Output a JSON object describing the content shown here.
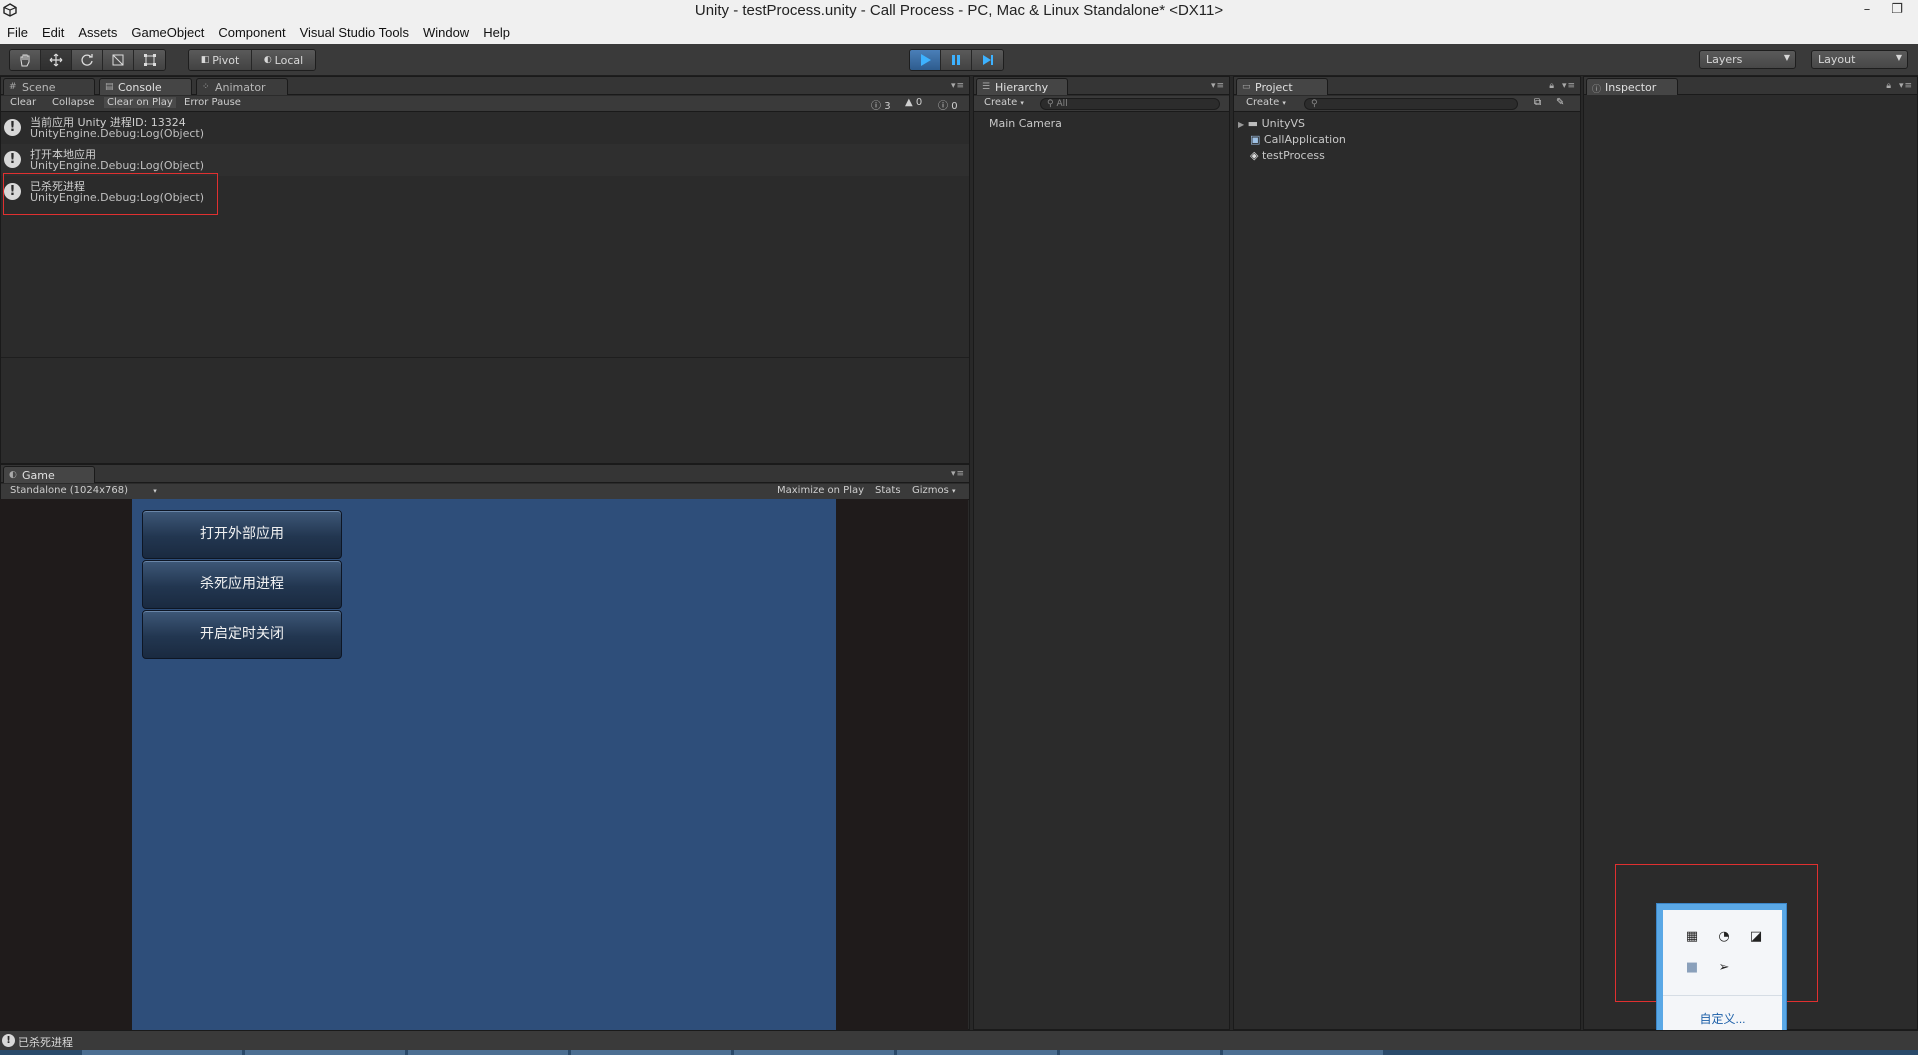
{
  "window": {
    "title": "Unity - testProcess.unity - Call Process - PC, Mac & Linux Standalone* <DX11>",
    "minimize": "–",
    "restore": "❐",
    "close": "✕"
  },
  "menu": [
    "File",
    "Edit",
    "Assets",
    "GameObject",
    "Component",
    "Visual Studio Tools",
    "Window",
    "Help"
  ],
  "toolbar": {
    "pivot_label": "Pivot",
    "local_label": "Local",
    "layers_label": "Layers",
    "layout_label": "Layout"
  },
  "console": {
    "tabs": {
      "scene": "Scene",
      "console": "Console",
      "animator": "Animator"
    },
    "buttons": {
      "clear": "Clear",
      "collapse": "Collapse",
      "clear_on_play": "Clear on Play",
      "error_pause": "Error Pause"
    },
    "counts": {
      "info": "3",
      "warning": "0",
      "error": "0"
    },
    "entries": [
      {
        "line1": "当前应用   Unity 进程ID: 13324",
        "line2": "UnityEngine.Debug:Log(Object)"
      },
      {
        "line1": "打开本地应用",
        "line2": "UnityEngine.Debug:Log(Object)"
      },
      {
        "line1": "已杀死进程",
        "line2": "UnityEngine.Debug:Log(Object)"
      }
    ]
  },
  "hierarchy": {
    "tab": "Hierarchy",
    "create": "Create",
    "search_placeholder": "All",
    "items": [
      "Main Camera"
    ]
  },
  "project": {
    "tab": "Project",
    "create": "Create",
    "items": [
      {
        "name": "UnityVS",
        "icon": "folder-icon"
      },
      {
        "name": "CallApplication",
        "icon": "script-icon"
      },
      {
        "name": "testProcess",
        "icon": "unity-scene-icon"
      }
    ]
  },
  "inspector": {
    "tab": "Inspector"
  },
  "game": {
    "tab": "Game",
    "resolution": "Standalone (1024x768)",
    "maximize_on_play": "Maximize on Play",
    "stats": "Stats",
    "gizmos": "Gizmos",
    "buttons": [
      "打开外部应用",
      "杀死应用进程",
      "开启定时关闭"
    ]
  },
  "tray": {
    "customize": "自定义..."
  },
  "status": {
    "message": "已杀死进程"
  },
  "colors": {
    "editor_bg": "#2b2b2b",
    "game_canvas": "#2e4e7a",
    "play_active": "#3d73ad",
    "highlight_box": "#e03030",
    "tray_border": "#5aa8e6"
  }
}
